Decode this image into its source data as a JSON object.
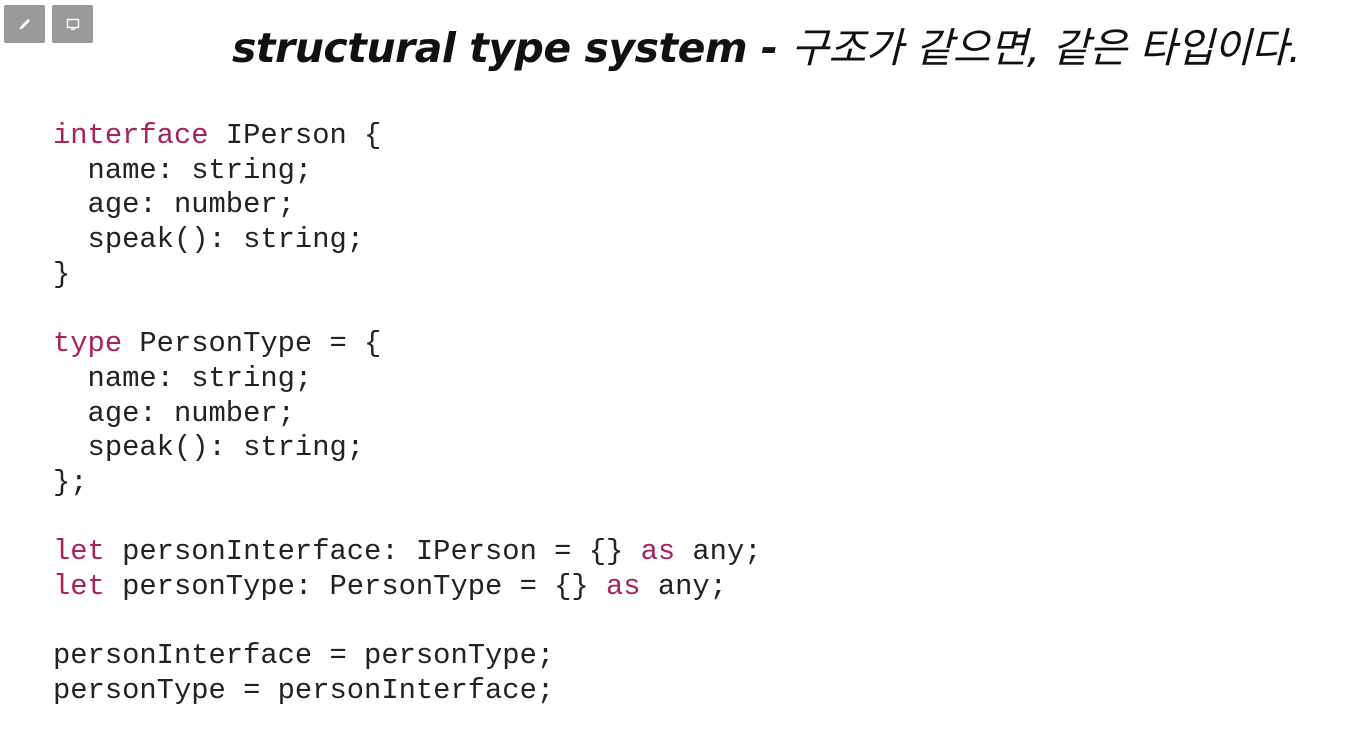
{
  "toolbar": {
    "buttons": [
      {
        "name": "pen-icon"
      },
      {
        "name": "screen-icon"
      }
    ]
  },
  "slide": {
    "title_en": "structural type system - ",
    "title_ko": "구조가 같으면, 같은 타입이다."
  },
  "colors": {
    "keyword": "#a8235a",
    "text": "#222222",
    "button": "#9a9a9a"
  },
  "code": {
    "lines": [
      [
        {
          "t": "interface",
          "k": true
        },
        {
          "t": " IPerson {"
        }
      ],
      [
        {
          "t": "  name: string;"
        }
      ],
      [
        {
          "t": "  age: number;"
        }
      ],
      [
        {
          "t": "  speak(): string;"
        }
      ],
      [
        {
          "t": "}"
        }
      ],
      [],
      [
        {
          "t": "type",
          "k": true
        },
        {
          "t": " PersonType = {"
        }
      ],
      [
        {
          "t": "  name: string;"
        }
      ],
      [
        {
          "t": "  age: number;"
        }
      ],
      [
        {
          "t": "  speak(): string;"
        }
      ],
      [
        {
          "t": "};"
        }
      ],
      [],
      [
        {
          "t": "let",
          "k": true
        },
        {
          "t": " personInterface: IPerson = {} "
        },
        {
          "t": "as",
          "k": true
        },
        {
          "t": " any;"
        }
      ],
      [
        {
          "t": "let",
          "k": true
        },
        {
          "t": " personType: PersonType = {} "
        },
        {
          "t": "as",
          "k": true
        },
        {
          "t": " any;"
        }
      ],
      [],
      [
        {
          "t": "personInterface = personType;"
        }
      ],
      [
        {
          "t": "personType = personInterface;"
        }
      ]
    ]
  }
}
